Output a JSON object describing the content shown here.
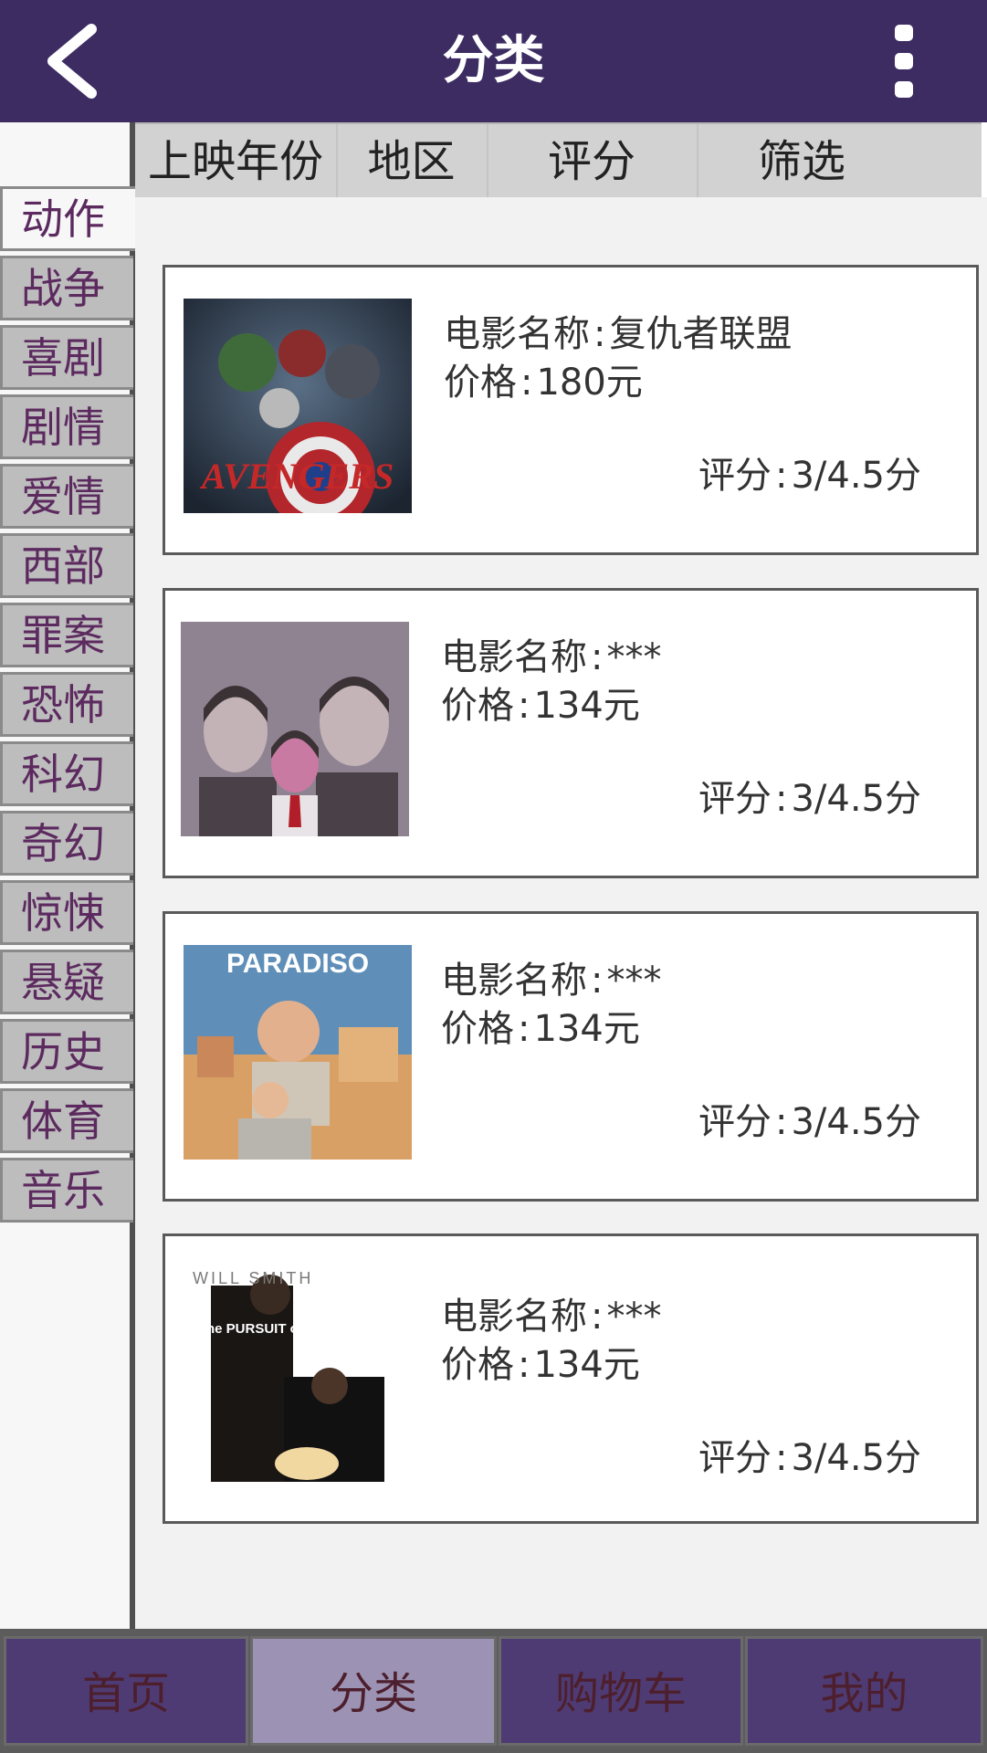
{
  "header": {
    "title": "分类",
    "back_icon": "chevron-left-icon",
    "more_icon": "more-vert-icon"
  },
  "filters": [
    "上映年份",
    "地区",
    "评分",
    "筛选"
  ],
  "sidebar": {
    "categories": [
      "动作",
      "战争",
      "喜剧",
      "剧情",
      "爱情",
      "西部",
      "罪案",
      "恐怖",
      "科幻",
      "奇幻",
      "惊悚",
      "悬疑",
      "历史",
      "体育",
      "音乐"
    ],
    "active_index": 0
  },
  "movies": [
    {
      "name_label": "电影名称",
      "name": "复仇者联盟",
      "price_label": "价格",
      "price": "180元",
      "rating_label": "评分",
      "rating": "3/4.5分",
      "poster_title": "AVENGERS"
    },
    {
      "name_label": "电影名称",
      "name": "***",
      "price_label": "价格",
      "price": "134元",
      "rating_label": "评分",
      "rating": "3/4.5分",
      "poster_title": ""
    },
    {
      "name_label": "电影名称",
      "name": "***",
      "price_label": "价格",
      "price": "134元",
      "rating_label": "评分",
      "rating": "3/4.5分",
      "poster_title": "PARADISO"
    },
    {
      "name_label": "电影名称",
      "name": "***",
      "price_label": "价格",
      "price": "134元",
      "rating_label": "评分",
      "rating": "3/4.5分",
      "poster_title": "WILL SMITH",
      "poster_subtitle": "the PURSUIT of HAPPYNESS"
    }
  ],
  "bottom_nav": {
    "items": [
      "首页",
      "分类",
      "购物车",
      "我的"
    ],
    "active_index": 1
  },
  "colors": {
    "header_bg": "#3c2c62",
    "nav_bg": "#4e3b73",
    "nav_active_bg": "#9c93b4",
    "category_text": "#5c2a5f"
  }
}
